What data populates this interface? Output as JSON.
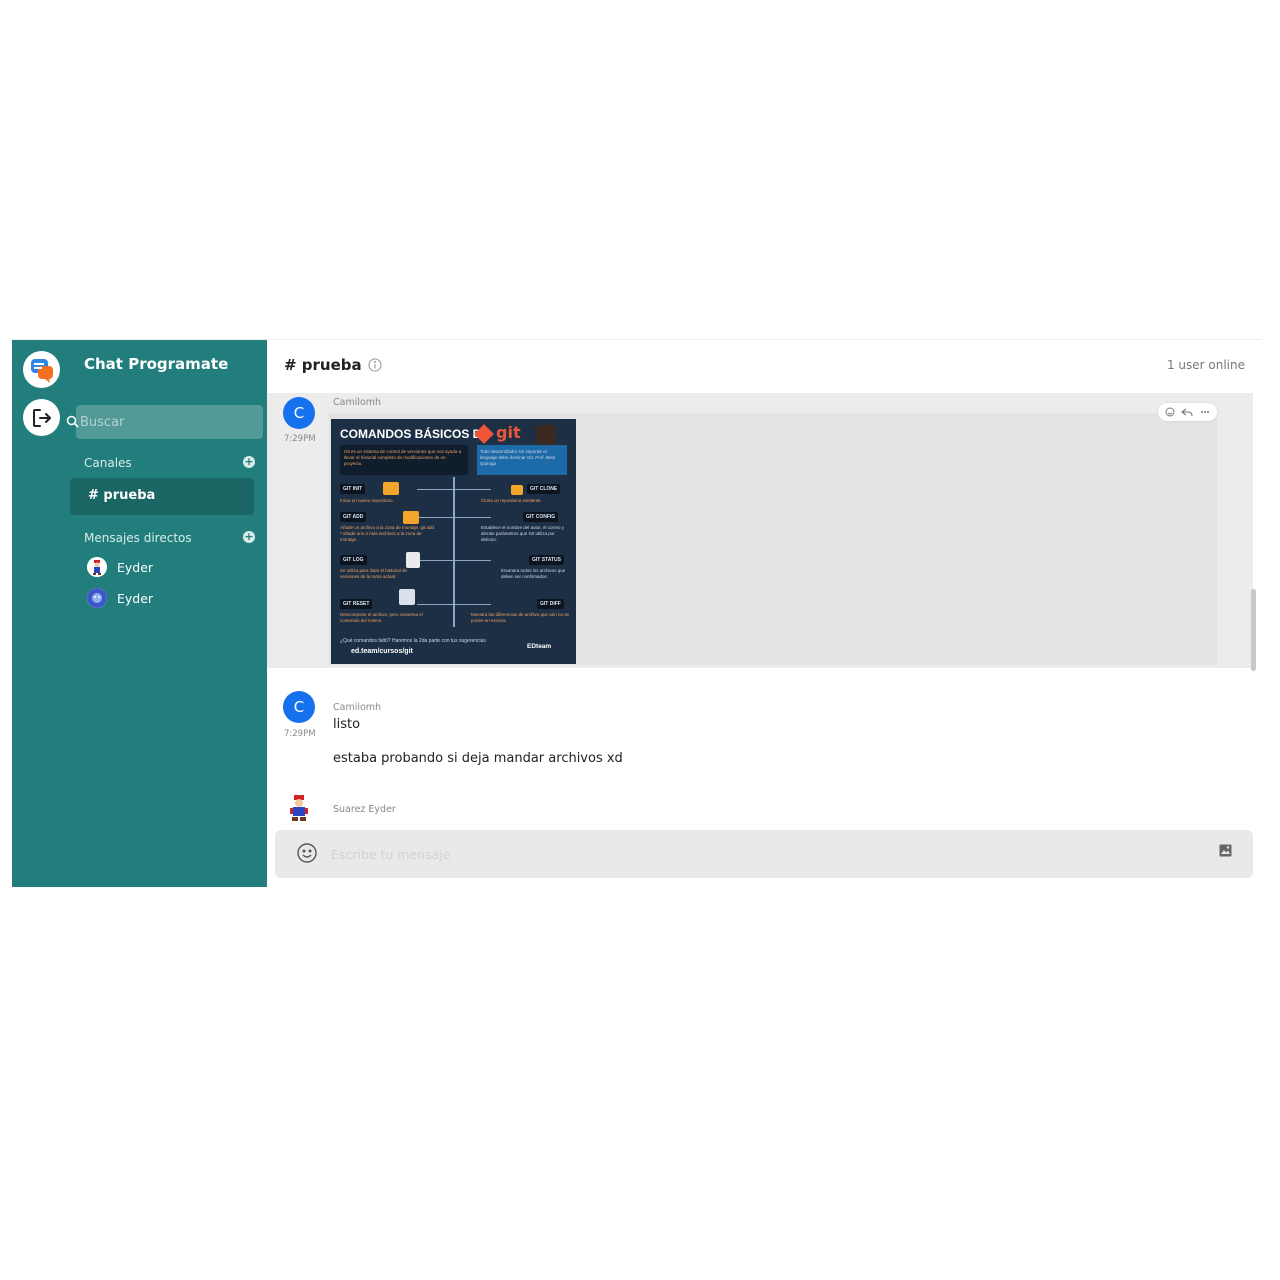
{
  "app": {
    "title": "Chat Programate"
  },
  "search": {
    "placeholder": "Buscar"
  },
  "sidebar": {
    "channels_label": "Canales",
    "active_channel": "# prueba",
    "dm_label": "Mensajes directos",
    "dms": [
      {
        "name": "Eyder"
      },
      {
        "name": "Eyder"
      }
    ]
  },
  "header": {
    "channel": "# prueba",
    "users_online": "1 user online"
  },
  "messages": [
    {
      "avatar_initial": "C",
      "author": "Camilomh",
      "time": "7:29PM",
      "image": {
        "title": "COMANDOS BÁSICOS DE",
        "brand": "git",
        "intro_left": "Git es un sistema de control de versiones que nos ayuda a llevar el historial completo de modificaciones de un proyecto.",
        "intro_right": "Todo desarrollador sin importar el lenguaje debe dominar Git. Prof. Beto Quiroga",
        "commands": [
          {
            "name": "GIT INIT",
            "desc": "Inicia un nuevo repositorio."
          },
          {
            "name": "GIT CLONE",
            "desc": "Clona un repositorio existente."
          },
          {
            "name": "GIT ADD",
            "desc": "Añade un archivo a la zona de montaje. git add * añade uno o más archivos a la zona de montaje."
          },
          {
            "name": "GIT CONFIG",
            "desc": "Establece el nombre del autor, el correo y demás parámetros que Git utiliza por defecto."
          },
          {
            "name": "GIT LOG",
            "desc": "Se utiliza para listar el historial de versiones de la rama actual."
          },
          {
            "name": "GIT STATUS",
            "desc": "Enumera todos los archivos que deben ser confirmados."
          },
          {
            "name": "GIT RESET",
            "desc": "Descompone el archivo, pero conserva el contenido del mismo."
          },
          {
            "name": "GIT DIFF",
            "desc": "Muestra las diferencias de archivo que aún no se ponen en escena."
          }
        ],
        "footer_question": "¿Qué comandos faltó? Haremos la 2da parte con tus sugerencias",
        "footer_link": "ed.team/cursos/git",
        "footer_brand": "EDteam"
      }
    },
    {
      "avatar_initial": "C",
      "author": "Camilomh",
      "time": "7:29PM",
      "lines": [
        "listo",
        "estaba probando si deja mandar archivos xd"
      ]
    },
    {
      "author": "Suarez Eyder"
    }
  ],
  "composer": {
    "placeholder": "Escribe tu mensaje"
  },
  "icons": {
    "logo": "chat-bubbles-icon",
    "logout": "logout-icon",
    "search": "search-icon",
    "info": "info-icon",
    "emoji": "emoji-icon",
    "image": "image-icon",
    "reaction": "smiley-icon",
    "reply": "reply-icon",
    "more": "more-icon"
  },
  "colors": {
    "sidebar": "#217e7c",
    "sidebar_active": "#1a6664",
    "avatar": "#1671ee"
  }
}
